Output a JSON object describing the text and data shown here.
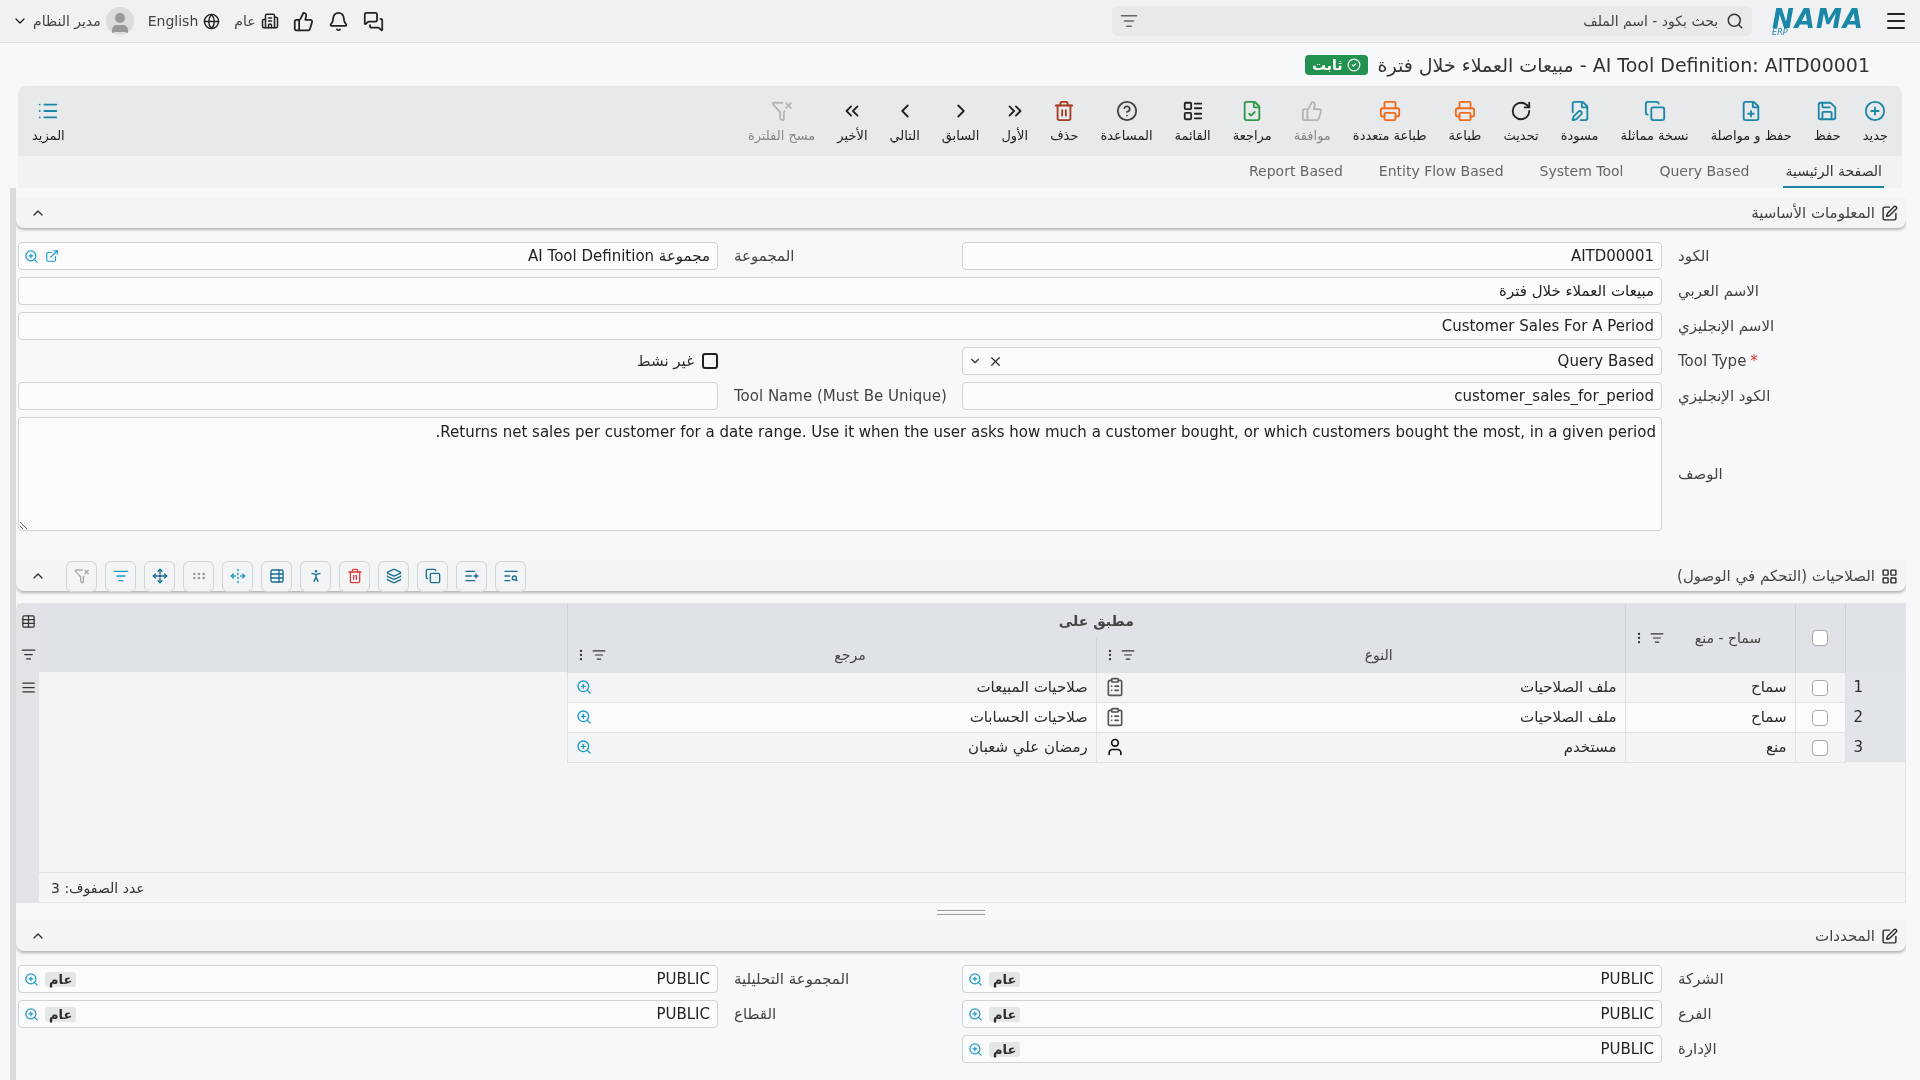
{
  "top_bar": {
    "logo": "NAMA",
    "logo_sub": "ERP",
    "search": {
      "placeholder": "بحث بكود - اسم الملف"
    },
    "company": "عام",
    "language": "English",
    "user": "مدير النظام"
  },
  "title": "AI Tool Definition: AITD00001 - مبيعات العملاء خلال فترة",
  "status_badge": "ثابت",
  "toolbar": [
    {
      "label": "جديد",
      "disabled": false
    },
    {
      "label": "حفظ",
      "disabled": false
    },
    {
      "label": "حفظ و مواصلة",
      "disabled": false
    },
    {
      "label": "نسخة مماثلة",
      "disabled": false
    },
    {
      "label": "مسودة",
      "disabled": false
    },
    {
      "label": "تحديث",
      "disabled": false
    },
    {
      "label": "طباعة",
      "disabled": false
    },
    {
      "label": "طباعة متعددة",
      "disabled": false
    },
    {
      "label": "موافقة",
      "disabled": true
    },
    {
      "label": "مراجعة",
      "disabled": false
    },
    {
      "label": "القائمة",
      "disabled": false
    },
    {
      "label": "المساعدة",
      "disabled": false
    },
    {
      "label": "حذف",
      "disabled": false
    },
    {
      "label": "الأول",
      "disabled": false
    },
    {
      "label": "السابق",
      "disabled": false
    },
    {
      "label": "التالي",
      "disabled": false
    },
    {
      "label": "الأخير",
      "disabled": false
    },
    {
      "label": "مسح الفلترة",
      "disabled": true
    }
  ],
  "more_button": "المزيد",
  "tabs": [
    {
      "label": "الصفحة الرئيسية",
      "selected": true
    },
    {
      "label": "Query Based",
      "selected": false
    },
    {
      "label": "System Tool",
      "selected": false
    },
    {
      "label": "Entity Flow Based",
      "selected": false
    },
    {
      "label": "Report Based",
      "selected": false
    }
  ],
  "basic_info": {
    "title": "المعلومات الأساسية",
    "code": {
      "label": "الكود",
      "value": "AITD00001"
    },
    "group": {
      "label": "المجموعة",
      "value": "مجموعة AI Tool Definition"
    },
    "arabic_name": {
      "label": "الاسم العربي",
      "value": "مبيعات العملاء خلال فترة"
    },
    "english_name": {
      "label": "الاسم الإنجليزي",
      "value": "Customer Sales For A Period"
    },
    "tool_type": {
      "label": "Tool Type",
      "required_mark": "*",
      "value": "Query Based"
    },
    "inactive": {
      "label": "غير نشط",
      "checked": false
    },
    "english_code": {
      "label": "الكود الإنجليزي",
      "value": "customer_sales_for_period"
    },
    "tool_name": {
      "label": "Tool Name (Must Be Unique)"
    },
    "description": {
      "label": "الوصف",
      "value": "Returns net sales per customer for a date range. Use it when the user asks how much a customer bought, or which customers bought the most, in a given period."
    }
  },
  "permissions": {
    "title": "الصلاحيات (التحكم في الوصول)",
    "columns": {
      "allow_deny": "سماح - منع",
      "applied_on": "مطبق على",
      "type": "النوع",
      "reference": "مرجع"
    },
    "rows": [
      {
        "number": "1",
        "checked": false,
        "allow_deny": "سماح",
        "type": "ملف الصلاحيات",
        "kind": "profile",
        "reference": "صلاحيات المبيعات"
      },
      {
        "number": "2",
        "checked": false,
        "allow_deny": "سماح",
        "type": "ملف الصلاحيات",
        "kind": "profile",
        "reference": "صلاحيات الحسابات"
      },
      {
        "number": "3",
        "checked": false,
        "allow_deny": "منع",
        "type": "مستخدم",
        "kind": "user",
        "reference": "رمضان علي شعبان"
      }
    ],
    "select_all_checked": false,
    "row_count_label": "عدد الصفوف:",
    "row_count": "3"
  },
  "determinants": {
    "title": "المحددات",
    "fields": [
      {
        "label": "الشركة",
        "value": "PUBLIC",
        "tag": "عام"
      },
      {
        "label": "المجموعة التحليلية",
        "value": "PUBLIC",
        "tag": "عام"
      },
      {
        "label": "الفرع",
        "value": "PUBLIC",
        "tag": "عام"
      },
      {
        "label": "القطاع",
        "value": "PUBLIC",
        "tag": "عام"
      },
      {
        "label": "الإدارة",
        "value": "PUBLIC",
        "tag": "عام"
      }
    ]
  }
}
